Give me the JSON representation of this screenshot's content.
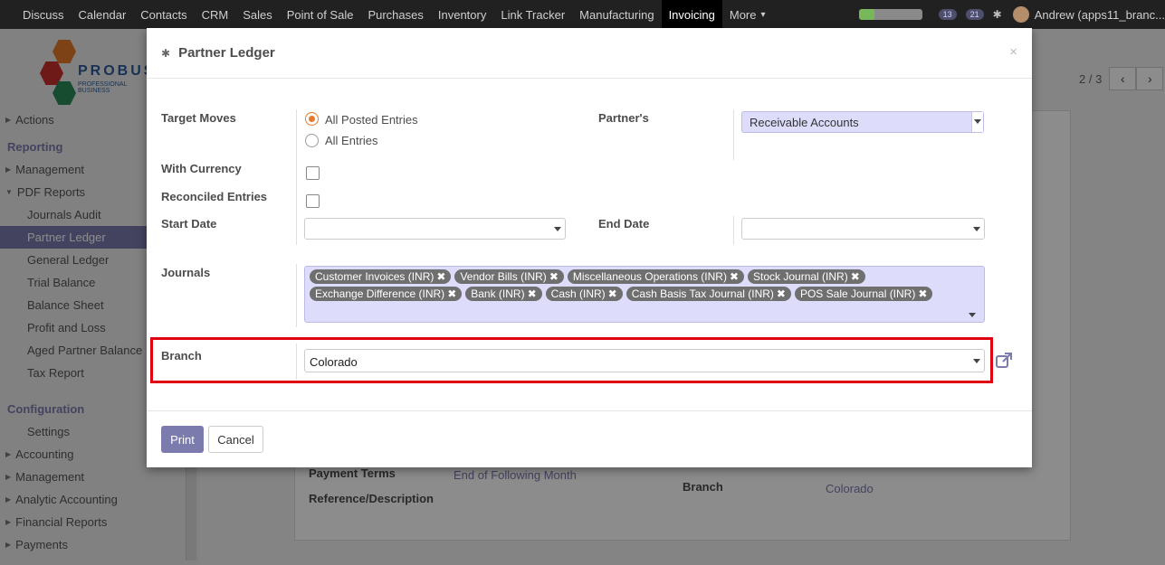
{
  "topbar": {
    "menu": [
      "Discuss",
      "Calendar",
      "Contacts",
      "CRM",
      "Sales",
      "Point of Sale",
      "Purchases",
      "Inventory",
      "Link Tracker",
      "Manufacturing",
      "Invoicing",
      "More"
    ],
    "active": "Invoicing",
    "progress": 0.25,
    "badge_messages": "13",
    "badge_activities": "21",
    "user": "Andrew (apps11_branc..."
  },
  "logo": {
    "name": "PROBUS",
    "tagline": "PROFESSIONAL BUSINESS"
  },
  "sidebar": {
    "items": [
      {
        "label": "Actions",
        "kind": "parent"
      },
      {
        "label": "Reporting",
        "kind": "section"
      },
      {
        "label": "Management",
        "kind": "parent"
      },
      {
        "label": "PDF Reports",
        "kind": "parent-open"
      },
      {
        "label": "Journals Audit",
        "kind": "child"
      },
      {
        "label": "Partner Ledger",
        "kind": "child-active"
      },
      {
        "label": "General Ledger",
        "kind": "child"
      },
      {
        "label": "Trial Balance",
        "kind": "child"
      },
      {
        "label": "Balance Sheet",
        "kind": "child"
      },
      {
        "label": "Profit and Loss",
        "kind": "child"
      },
      {
        "label": "Aged Partner Balance",
        "kind": "child"
      },
      {
        "label": "Tax Report",
        "kind": "child"
      },
      {
        "label": "Configuration",
        "kind": "section"
      },
      {
        "label": "Settings",
        "kind": "child-plain"
      },
      {
        "label": "Accounting",
        "kind": "parent"
      },
      {
        "label": "Management",
        "kind": "parent"
      },
      {
        "label": "Analytic Accounting",
        "kind": "parent"
      },
      {
        "label": "Financial Reports",
        "kind": "parent"
      },
      {
        "label": "Payments",
        "kind": "parent"
      }
    ]
  },
  "pager": {
    "text": "2 / 3",
    "prev": "‹",
    "next": "›"
  },
  "background_form": {
    "payment_terms_label": "Payment Terms",
    "payment_terms_value": "End of Following Month",
    "reference_label": "Reference/Description",
    "branch_label": "Branch",
    "branch_value": "Colorado"
  },
  "modal": {
    "title": "Partner Ledger",
    "close": "×",
    "target_moves_label": "Target Moves",
    "target_moves_options": [
      "All Posted Entries",
      "All Entries"
    ],
    "target_moves_selected": "All Posted Entries",
    "partners_label": "Partner's",
    "partners_value": "Receivable Accounts",
    "with_currency_label": "With Currency",
    "reconciled_label": "Reconciled Entries",
    "start_date_label": "Start Date",
    "start_date_value": "",
    "end_date_label": "End Date",
    "end_date_value": "",
    "journals_label": "Journals",
    "journals": [
      "Customer Invoices (INR)",
      "Vendor Bills (INR)",
      "Miscellaneous Operations (INR)",
      "Stock Journal (INR)",
      "Exchange Difference (INR)",
      "Bank (INR)",
      "Cash (INR)",
      "Cash Basis Tax Journal (INR)",
      "POS Sale Journal (INR)"
    ],
    "tag_remove": "✖",
    "branch_label": "Branch",
    "branch_value": "Colorado",
    "print_label": "Print",
    "cancel_label": "Cancel"
  },
  "colors": {
    "accent": "#7c7bad",
    "highlight_box": "#e0000f",
    "radio": "#e6792a"
  }
}
